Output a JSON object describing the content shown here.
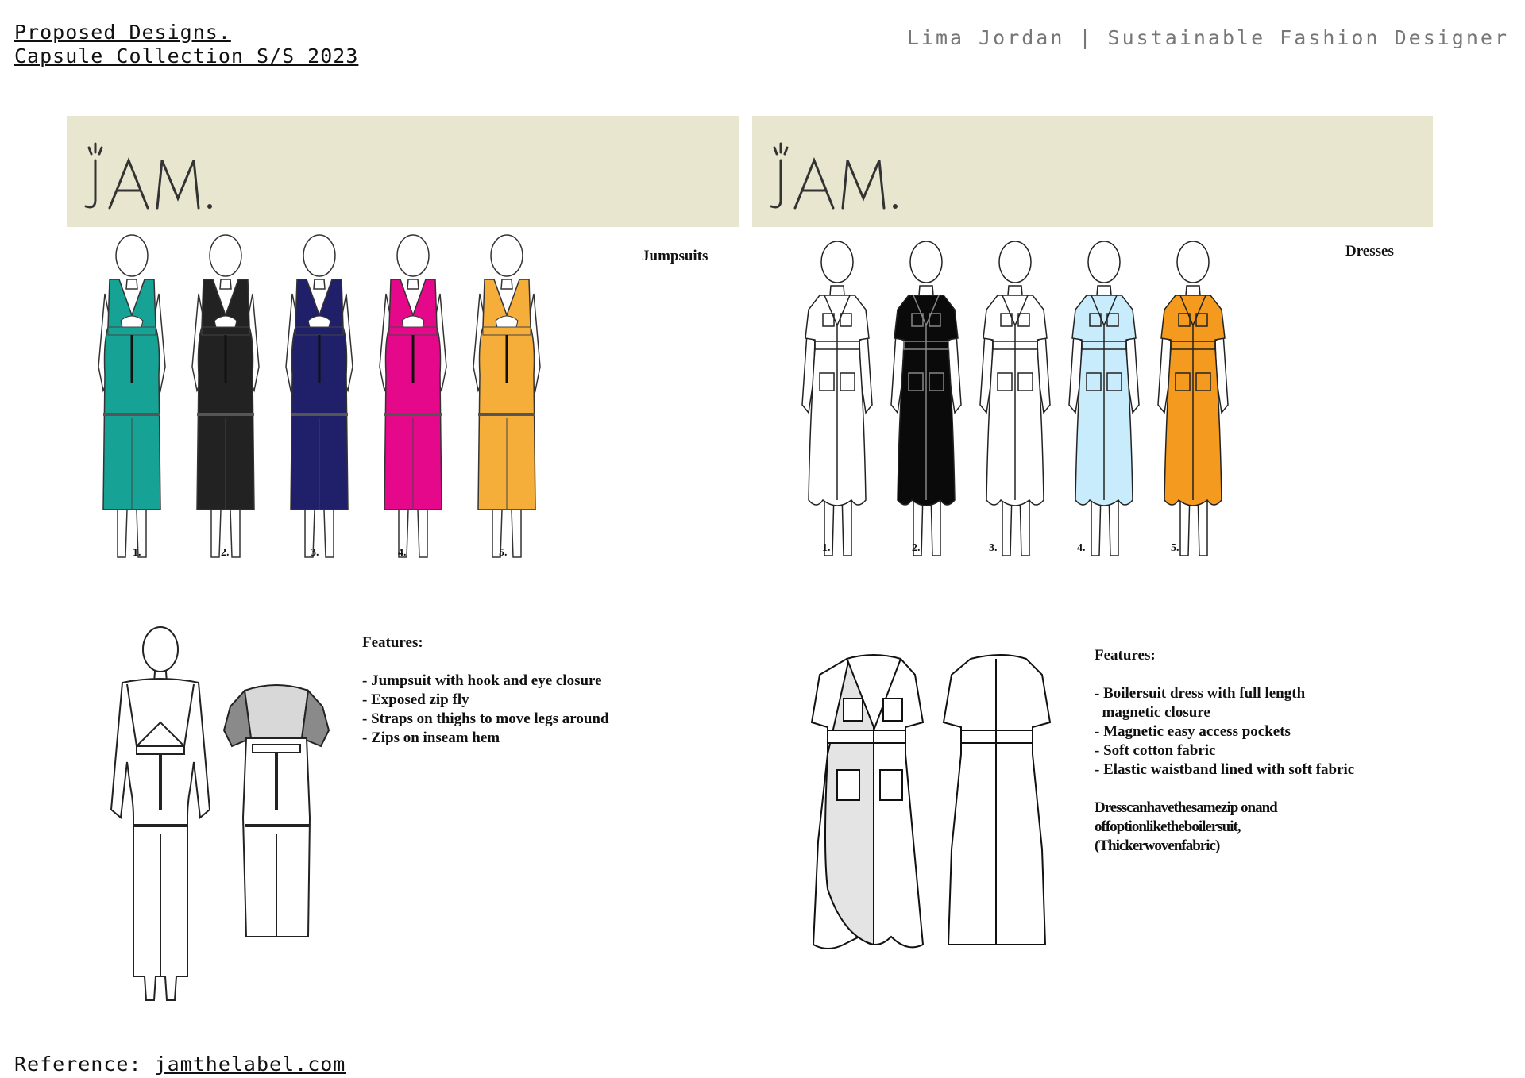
{
  "header": {
    "title_line1": "Proposed Designs.",
    "title_line2": "Capsule Collection S/S 2023",
    "designer": "Lima Jordan | Sustainable Fashion Designer"
  },
  "brand": {
    "logo_text": "JAM."
  },
  "jumpsuits": {
    "label": "Jumpsuits",
    "numbers": [
      "1.",
      "2.",
      "3.",
      "4.",
      "5."
    ],
    "colors": [
      "#16a396",
      "#1c1c1c",
      "#20206a",
      "#e6088a",
      "#f6ae3a"
    ],
    "features_title": "Features:",
    "features": [
      "- Jumpsuit with hook and eye closure",
      "- Exposed zip fly",
      "- Straps on thighs to move legs around",
      "- Zips on inseam hem"
    ]
  },
  "dresses": {
    "label": "Dresses",
    "numbers": [
      "1.",
      "2.",
      "3.",
      "4.",
      "5."
    ],
    "colors": [
      "#ffffff",
      "#0a0a0a",
      "#ffffff",
      "#c8ecfb",
      "#f39a1f"
    ],
    "features_title": "Features:",
    "features": [
      "- Boilersuit dress with full length",
      "  magnetic closure",
      "- Magnetic easy access pockets",
      "- Soft cotton fabric",
      "- Elastic waistband lined with soft fabric"
    ],
    "note_lines": [
      "Dresscanhavethesamezip onand",
      "offoptionliketheboilersuit,",
      "(Thickerwovenfabric)"
    ]
  },
  "footer": {
    "label": "Reference:",
    "link": "jamthelabel.com"
  }
}
